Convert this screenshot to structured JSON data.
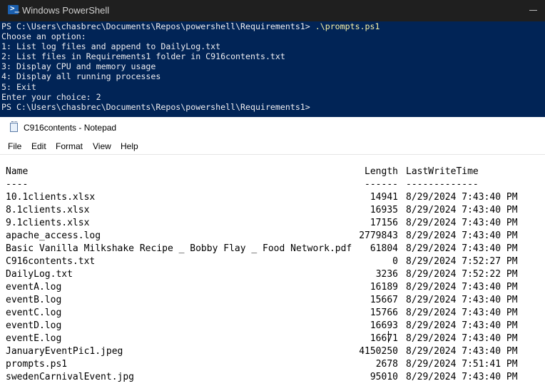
{
  "powershell": {
    "title": "Windows PowerShell",
    "prompt1": "PS C:\\Users\\chasbrec\\Documents\\Repos\\powershell\\Requirements1> ",
    "command": ".\\prompts.ps1",
    "lines": [
      "Choose an option:",
      "1: List log files and append to DailyLog.txt",
      "2: List files in Requirements1 folder in C916contents.txt",
      "3: Display CPU and memory usage",
      "4: Display all running processes",
      "5: Exit",
      "Enter your choice: 2",
      "PS C:\\Users\\chasbrec\\Documents\\Repos\\powershell\\Requirements1>"
    ]
  },
  "notepad": {
    "title": "C916contents - Notepad",
    "menu": [
      "File",
      "Edit",
      "Format",
      "View",
      "Help"
    ],
    "headers": {
      "name": "Name",
      "length": "Length",
      "time": "LastWriteTime"
    },
    "dashes": {
      "name": "----",
      "length": "------",
      "time": "-------------"
    },
    "files": [
      {
        "name": "10.1clients.xlsx",
        "length": "14941",
        "time": "8/29/2024 7:43:40 PM"
      },
      {
        "name": "8.1clients.xlsx",
        "length": "16935",
        "time": "8/29/2024 7:43:40 PM"
      },
      {
        "name": "9.1clients.xlsx",
        "length": "17156",
        "time": "8/29/2024 7:43:40 PM"
      },
      {
        "name": "apache_access.log",
        "length": "2779843",
        "time": "8/29/2024 7:43:40 PM"
      },
      {
        "name": "Basic Vanilla Milkshake Recipe _ Bobby Flay _ Food Network.pdf",
        "length": "61804",
        "time": "8/29/2024 7:43:40 PM"
      },
      {
        "name": "C916contents.txt",
        "length": "0",
        "time": "8/29/2024 7:52:27 PM"
      },
      {
        "name": "DailyLog.txt",
        "length": "3236",
        "time": "8/29/2024 7:52:22 PM"
      },
      {
        "name": "eventA.log",
        "length": "16189",
        "time": "8/29/2024 7:43:40 PM"
      },
      {
        "name": "eventB.log",
        "length": "15667",
        "time": "8/29/2024 7:43:40 PM"
      },
      {
        "name": "eventC.log",
        "length": "15766",
        "time": "8/29/2024 7:43:40 PM"
      },
      {
        "name": "eventD.log",
        "length": "16693",
        "time": "8/29/2024 7:43:40 PM"
      },
      {
        "name": "eventE.log",
        "length": "16671",
        "time": "8/29/2024 7:43:40 PM"
      },
      {
        "name": "JanuaryEventPic1.jpeg",
        "length": "4150250",
        "time": "8/29/2024 7:43:40 PM"
      },
      {
        "name": "prompts.ps1",
        "length": "2678",
        "time": "8/29/2024 7:51:41 PM"
      },
      {
        "name": "swedenCarnivalEvent.jpg",
        "length": "95010",
        "time": "8/29/2024 7:43:40 PM"
      }
    ]
  }
}
